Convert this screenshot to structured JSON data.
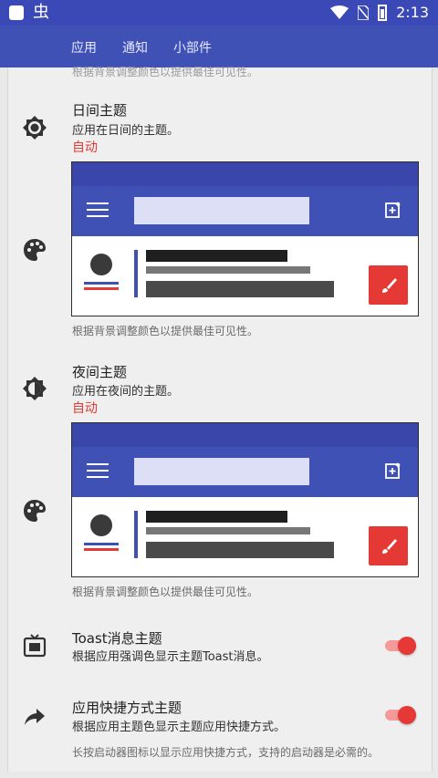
{
  "statusbar": {
    "time": "2:13",
    "bug_glyph": "虫",
    "icons": [
      "app-icon",
      "bug-icon",
      "wifi-icon",
      "no-sim-icon",
      "battery-icon"
    ]
  },
  "tabs": [
    "应用",
    "通知",
    "小部件"
  ],
  "header": {
    "faded_text": "根据背景调整颜色以提供最佳可见性。"
  },
  "day_theme": {
    "title": "日间主题",
    "subtitle": "应用在日间的主题。",
    "value": "自动",
    "desc": "根据背景调整颜色以提供最佳可见性。"
  },
  "night_theme": {
    "title": "夜间主题",
    "subtitle": "应用在夜间的主题。",
    "value": "自动",
    "desc": "根据背景调整颜色以提供最佳可见性。"
  },
  "toast": {
    "title": "Toast消息主题",
    "subtitle": "根据应用强调色显示主题Toast消息。",
    "enabled": true
  },
  "shortcut": {
    "title": "应用快捷方式主题",
    "subtitle": "根据应用主题色显示主题应用快捷方式。",
    "desc": "长按启动器图标以显示应用快捷方式，支持的启动器是必需的。",
    "enabled": true
  },
  "colors": {
    "primary": "#3f51b5",
    "accent": "#e53935",
    "status": "#3a49b5"
  }
}
